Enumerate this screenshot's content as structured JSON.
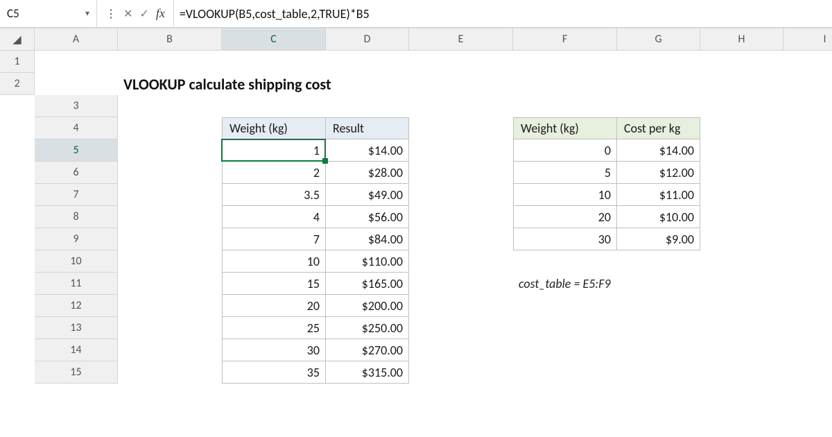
{
  "name_box": "C5",
  "formula": "=VLOOKUP(B5,cost_table,2,TRUE)*B5",
  "columns": [
    "A",
    "B",
    "C",
    "D",
    "E",
    "F",
    "G",
    "H",
    "I"
  ],
  "rows": [
    "1",
    "2",
    "3",
    "4",
    "5",
    "6",
    "7",
    "8",
    "9",
    "10",
    "11",
    "12",
    "13",
    "14",
    "15"
  ],
  "title": "VLOOKUP calculate shipping cost",
  "left_table": {
    "headers": [
      "Weight (kg)",
      "Result"
    ],
    "rows": [
      [
        "1",
        "$14.00"
      ],
      [
        "2",
        "$28.00"
      ],
      [
        "3.5",
        "$49.00"
      ],
      [
        "4",
        "$56.00"
      ],
      [
        "7",
        "$84.00"
      ],
      [
        "10",
        "$110.00"
      ],
      [
        "15",
        "$165.00"
      ],
      [
        "20",
        "$200.00"
      ],
      [
        "25",
        "$250.00"
      ],
      [
        "30",
        "$270.00"
      ],
      [
        "35",
        "$315.00"
      ]
    ]
  },
  "right_table": {
    "headers": [
      "Weight (kg)",
      "Cost per kg"
    ],
    "rows": [
      [
        "0",
        "$14.00"
      ],
      [
        "5",
        "$12.00"
      ],
      [
        "10",
        "$11.00"
      ],
      [
        "20",
        "$10.00"
      ],
      [
        "30",
        "$9.00"
      ]
    ]
  },
  "note": "cost_table = E5:F9",
  "selected_row": 5
}
